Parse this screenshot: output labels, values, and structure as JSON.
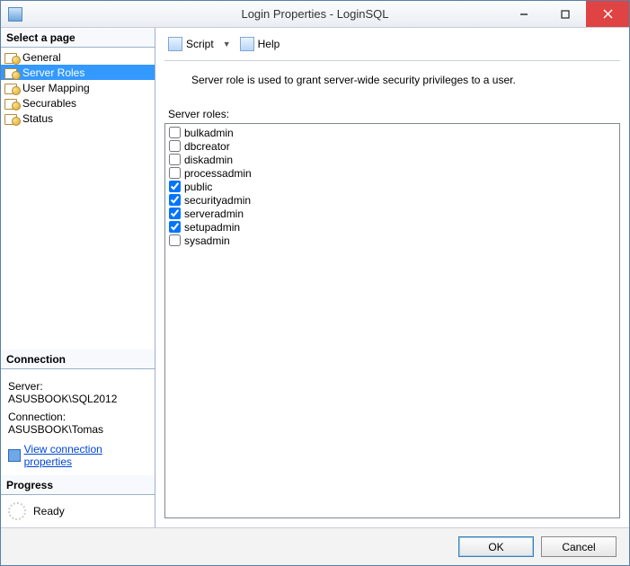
{
  "window": {
    "title": "Login Properties - LoginSQL"
  },
  "left": {
    "select_page_header": "Select a page",
    "pages": [
      {
        "label": "General",
        "selected": false
      },
      {
        "label": "Server Roles",
        "selected": true
      },
      {
        "label": "User Mapping",
        "selected": false
      },
      {
        "label": "Securables",
        "selected": false
      },
      {
        "label": "Status",
        "selected": false
      }
    ],
    "connection_header": "Connection",
    "server_label": "Server:",
    "server_value": "ASUSBOOK\\SQL2012",
    "connection_label": "Connection:",
    "connection_value": "ASUSBOOK\\Tomas",
    "view_conn_link": "View connection properties",
    "progress_header": "Progress",
    "progress_status": "Ready"
  },
  "toolbar": {
    "script_label": "Script",
    "help_label": "Help"
  },
  "main": {
    "description": "Server role is used to grant server-wide security privileges to a user.",
    "roles_label": "Server roles:",
    "roles": [
      {
        "name": "bulkadmin",
        "checked": false
      },
      {
        "name": "dbcreator",
        "checked": false
      },
      {
        "name": "diskadmin",
        "checked": false
      },
      {
        "name": "processadmin",
        "checked": false
      },
      {
        "name": "public",
        "checked": true
      },
      {
        "name": "securityadmin",
        "checked": true
      },
      {
        "name": "serveradmin",
        "checked": true
      },
      {
        "name": "setupadmin",
        "checked": true
      },
      {
        "name": "sysadmin",
        "checked": false
      }
    ]
  },
  "buttons": {
    "ok": "OK",
    "cancel": "Cancel"
  }
}
